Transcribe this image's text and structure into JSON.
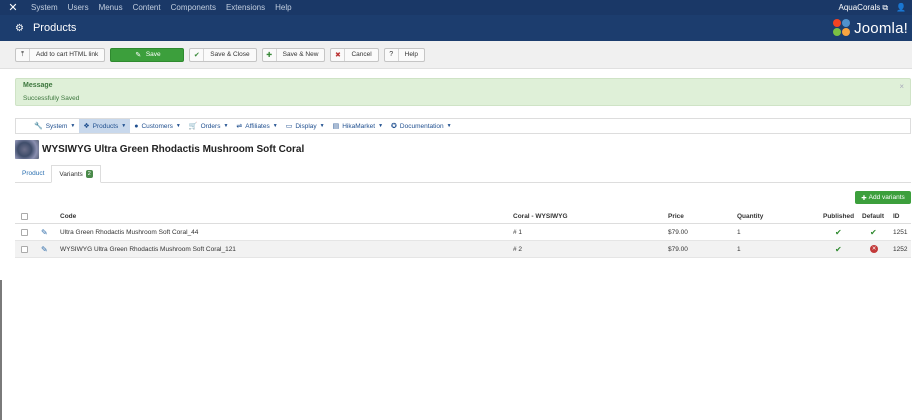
{
  "topbar": {
    "menu": [
      "System",
      "Users",
      "Menus",
      "Content",
      "Components",
      "Extensions",
      "Help"
    ],
    "site_name": "AquaCorals",
    "site_icon": "external-link-icon",
    "user_icon": "user-icon"
  },
  "header": {
    "title": "Products",
    "brand": "Joomla!"
  },
  "toolbar": {
    "add_cart_label": "Add to cart HTML link",
    "save_label": "Save",
    "save_close_label": "Save & Close",
    "save_new_label": "Save & New",
    "cancel_label": "Cancel",
    "help_label": "Help"
  },
  "alert": {
    "heading": "Message",
    "text": "Successfully Saved",
    "close": "×"
  },
  "nav": [
    {
      "label": "System",
      "icon": "wrench-icon"
    },
    {
      "label": "Products",
      "icon": "cubes-icon",
      "active": true
    },
    {
      "label": "Customers",
      "icon": "user-icon"
    },
    {
      "label": "Orders",
      "icon": "cart-icon"
    },
    {
      "label": "Affiliates",
      "icon": "share-icon"
    },
    {
      "label": "Display",
      "icon": "monitor-icon"
    },
    {
      "label": "HikaMarket",
      "icon": "store-icon"
    },
    {
      "label": "Documentation",
      "icon": "lifebuoy-icon"
    }
  ],
  "product": {
    "title": "WYSIWYG Ultra Green Rhodactis Mushroom Soft Coral"
  },
  "tabs": {
    "product": "Product",
    "variants": "Variants",
    "variants_count": "2"
  },
  "add_variants_label": "Add variants",
  "table": {
    "headers": {
      "code": "Code",
      "coral": "Coral - WYSIWYG",
      "price": "Price",
      "quantity": "Quantity",
      "published": "Published",
      "default": "Default",
      "id": "ID"
    },
    "rows": [
      {
        "code": "Ultra Green Rhodactis Mushroom Soft Coral_44",
        "coral": "# 1",
        "price": "$79.00",
        "quantity": "1",
        "published": true,
        "default": true,
        "id": "1251"
      },
      {
        "code": "WYSIWYG Ultra Green Rhodactis Mushroom Soft Coral_121",
        "coral": "# 2",
        "price": "$79.00",
        "quantity": "1",
        "published": true,
        "default": false,
        "id": "1252"
      }
    ]
  },
  "colors": {
    "topbar": "#1a3867",
    "header": "#1c3d6e",
    "success": "#3c9f3c",
    "alert_bg": "#dff0d8",
    "link": "#1f4f8f",
    "danger": "#c23a3a"
  }
}
